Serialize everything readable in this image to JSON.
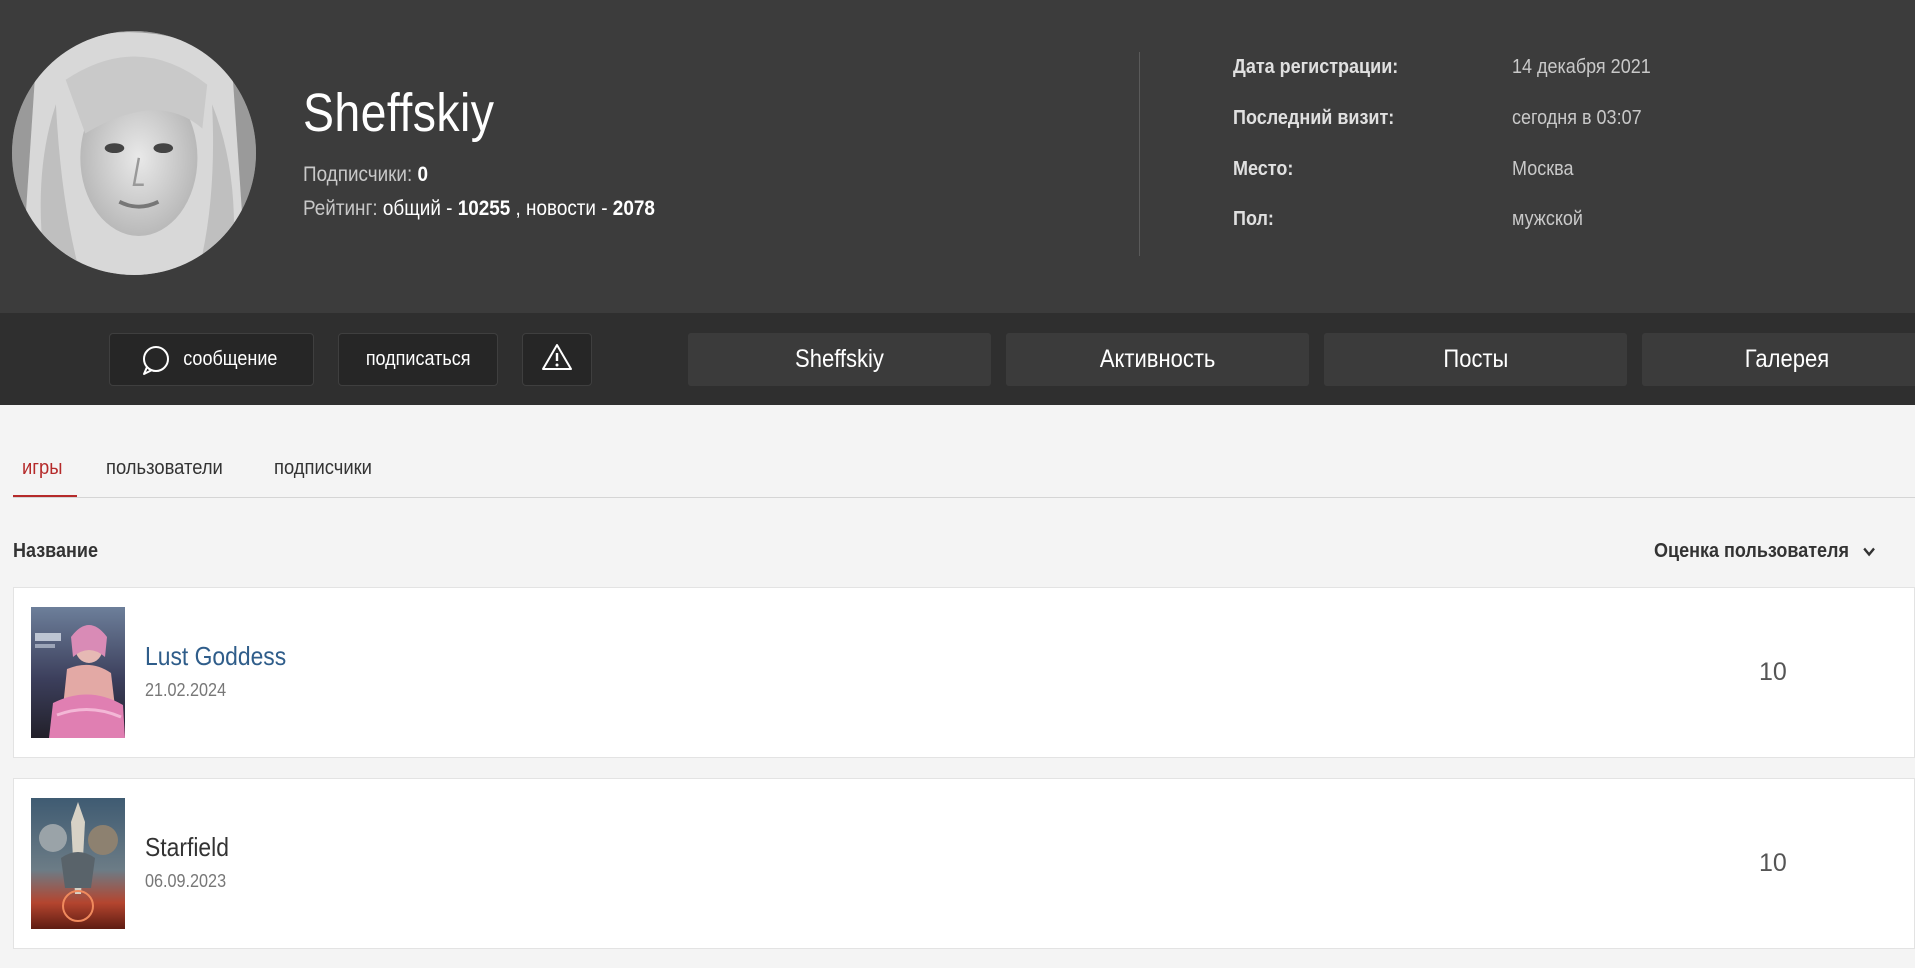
{
  "profile": {
    "username": "Sheffskiy",
    "followers_label": "Подписчики:",
    "followers_count": "0",
    "rating_label": "Рейтинг:",
    "rating_general_label": "общий -",
    "rating_general_value": "10255",
    "rating_news_label": ", новости -",
    "rating_news_value": "2078"
  },
  "info": [
    {
      "label": "Дата регистрации:",
      "value": "14 декабря 2021"
    },
    {
      "label": "Последний визит:",
      "value": "сегодня в 03:07"
    },
    {
      "label": "Место:",
      "value": "Москва"
    },
    {
      "label": "Пол:",
      "value": "мужской"
    }
  ],
  "actions": {
    "message_label": "сообщение",
    "subscribe_label": "подписаться"
  },
  "nav_tabs": [
    {
      "label": "Sheffskiy"
    },
    {
      "label": "Активность"
    },
    {
      "label": "Посты"
    },
    {
      "label": "Галерея"
    }
  ],
  "sub_tabs": [
    {
      "label": "игры",
      "active": true
    },
    {
      "label": "пользователи",
      "active": false
    },
    {
      "label": "подписчики",
      "active": false
    }
  ],
  "table": {
    "col_name": "Название",
    "col_rating": "Оценка пользователя",
    "rows": [
      {
        "title": "Lust Goddess",
        "date": "21.02.2024",
        "score": "10"
      },
      {
        "title": "Starfield",
        "date": "06.09.2023",
        "score": "10"
      }
    ]
  },
  "colors": {
    "header_bg": "#3c3c3c",
    "nav_bg": "#2f2f2f",
    "accent_red": "#b52a2a",
    "link_blue": "#2f5d8a"
  }
}
